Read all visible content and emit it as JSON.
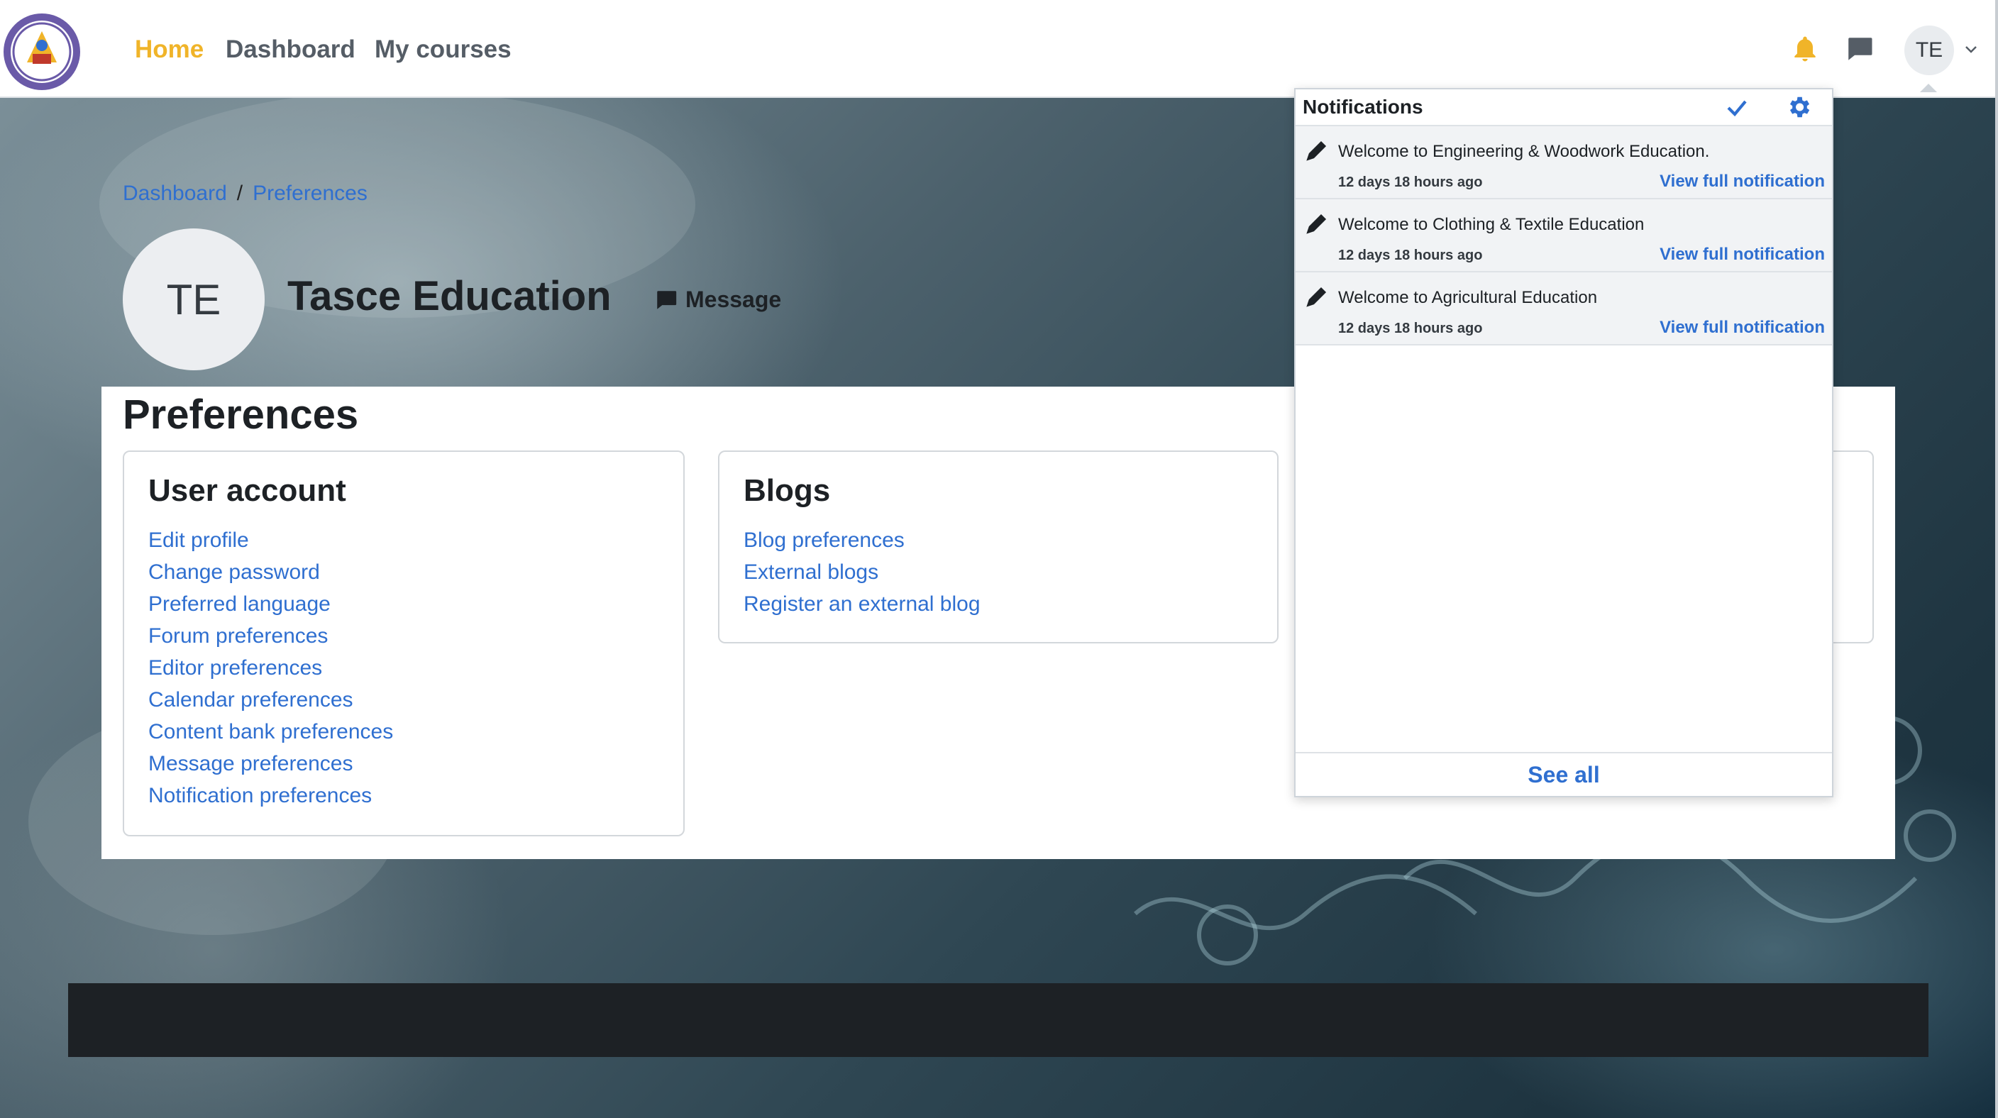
{
  "navbar": {
    "nav_links": [
      {
        "label": "Home",
        "active": true
      },
      {
        "label": "Dashboard",
        "active": false
      },
      {
        "label": "My courses",
        "active": false
      }
    ],
    "user_initials": "TE",
    "icons": {
      "notifications": "bell-icon",
      "messages": "chat-bubble-icon",
      "user_menu": "chevron-down-icon"
    },
    "accent_color": "#f0b429"
  },
  "breadcrumb": {
    "items": [
      "Dashboard",
      "Preferences"
    ],
    "separator": "/"
  },
  "profile": {
    "initials": "TE",
    "name": "Tasce Education",
    "message_label": "Message"
  },
  "page": {
    "title": "Preferences",
    "cards": [
      {
        "title": "User account",
        "links": [
          "Edit profile",
          "Change password",
          "Preferred language",
          "Forum preferences",
          "Editor preferences",
          "Calendar preferences",
          "Content bank preferences",
          "Message preferences",
          "Notification preferences"
        ]
      },
      {
        "title": "Blogs",
        "links": [
          "Blog preferences",
          "External blogs",
          "Register an external blog"
        ]
      }
    ]
  },
  "notifications": {
    "title": "Notifications",
    "items": [
      {
        "message": "Welcome to Engineering & Woodwork Education.",
        "time": "12 days 18 hours ago",
        "view_label": "View full notification"
      },
      {
        "message": "Welcome to Clothing & Textile Education",
        "time": "12 days 18 hours ago",
        "view_label": "View full notification"
      },
      {
        "message": "Welcome to Agricultural Education",
        "time": "12 days 18 hours ago",
        "view_label": "View full notification"
      }
    ],
    "see_all_label": "See all",
    "link_color": "#2f6fd0"
  }
}
